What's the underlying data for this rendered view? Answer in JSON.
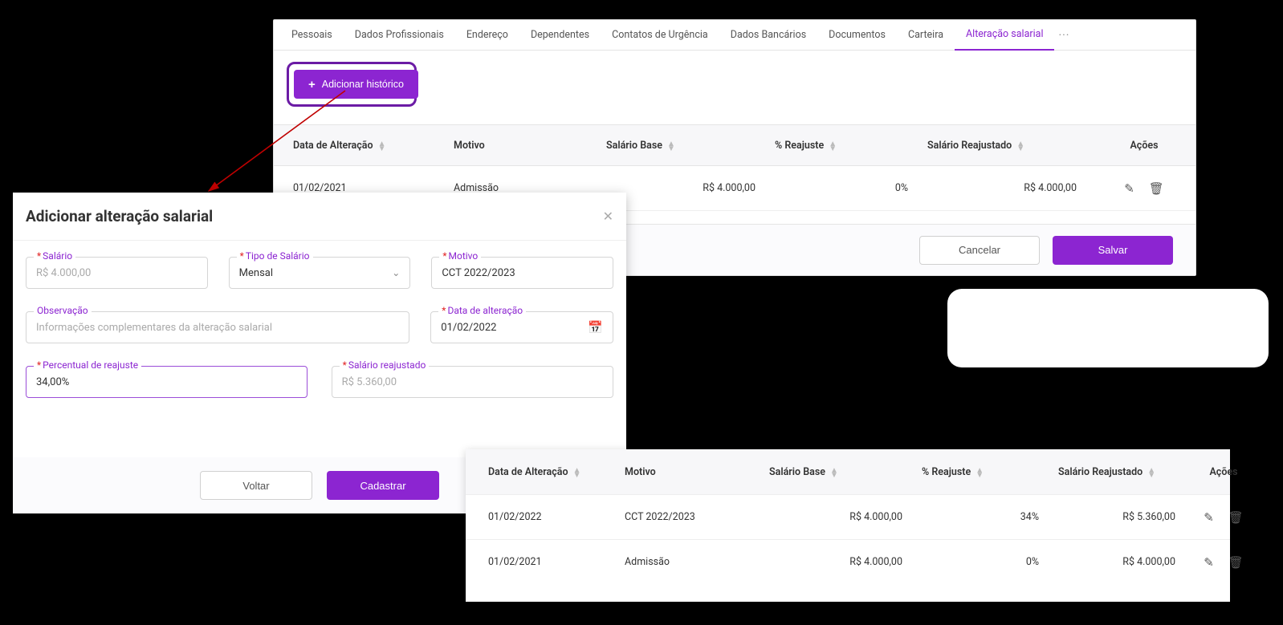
{
  "tabs": [
    "Pessoais",
    "Dados Profissionais",
    "Endereço",
    "Dependentes",
    "Contatos de Urgência",
    "Dados Bancários",
    "Documentos",
    "Carteira",
    "Alteração salarial"
  ],
  "add_button": "Adicionar histórico",
  "columns": {
    "data": "Data de Alteração",
    "motivo": "Motivo",
    "base": "Salário Base",
    "reajuste": "% Reajuste",
    "reajustado": "Salário Reajustado",
    "acoes": "Ações"
  },
  "table1_row": {
    "data": "01/02/2021",
    "motivo": "Admissão",
    "base": "R$ 4.000,00",
    "reajuste": "0%",
    "reajustado": "R$ 4.000,00"
  },
  "footer1": {
    "cancel": "Cancelar",
    "save": "Salvar"
  },
  "modal": {
    "title": "Adicionar alteração salarial",
    "salario_label": "Salário",
    "salario_placeholder": "R$ 4.000,00",
    "tipo_label": "Tipo de Salário",
    "tipo_value": "Mensal",
    "motivo_label": "Motivo",
    "motivo_value": "CCT 2022/2023",
    "obs_label": "Observação",
    "obs_placeholder": "Informações complementares da alteração salarial",
    "data_label": "Data de alteração",
    "data_value": "01/02/2022",
    "perc_label": "Percentual de reajuste",
    "perc_value": "34,00%",
    "reaj_label": "Salário reajustado",
    "reaj_value": "R$ 5.360,00",
    "voltar": "Voltar",
    "cadastrar": "Cadastrar"
  },
  "table3_row1": {
    "data": "01/02/2022",
    "motivo": "CCT 2022/2023",
    "base": "R$ 4.000,00",
    "reajuste": "34%",
    "reajustado": "R$ 5.360,00"
  },
  "table3_row2": {
    "data": "01/02/2021",
    "motivo": "Admissão",
    "base": "R$ 4.000,00",
    "reajuste": "0%",
    "reajustado": "R$ 4.000,00"
  }
}
